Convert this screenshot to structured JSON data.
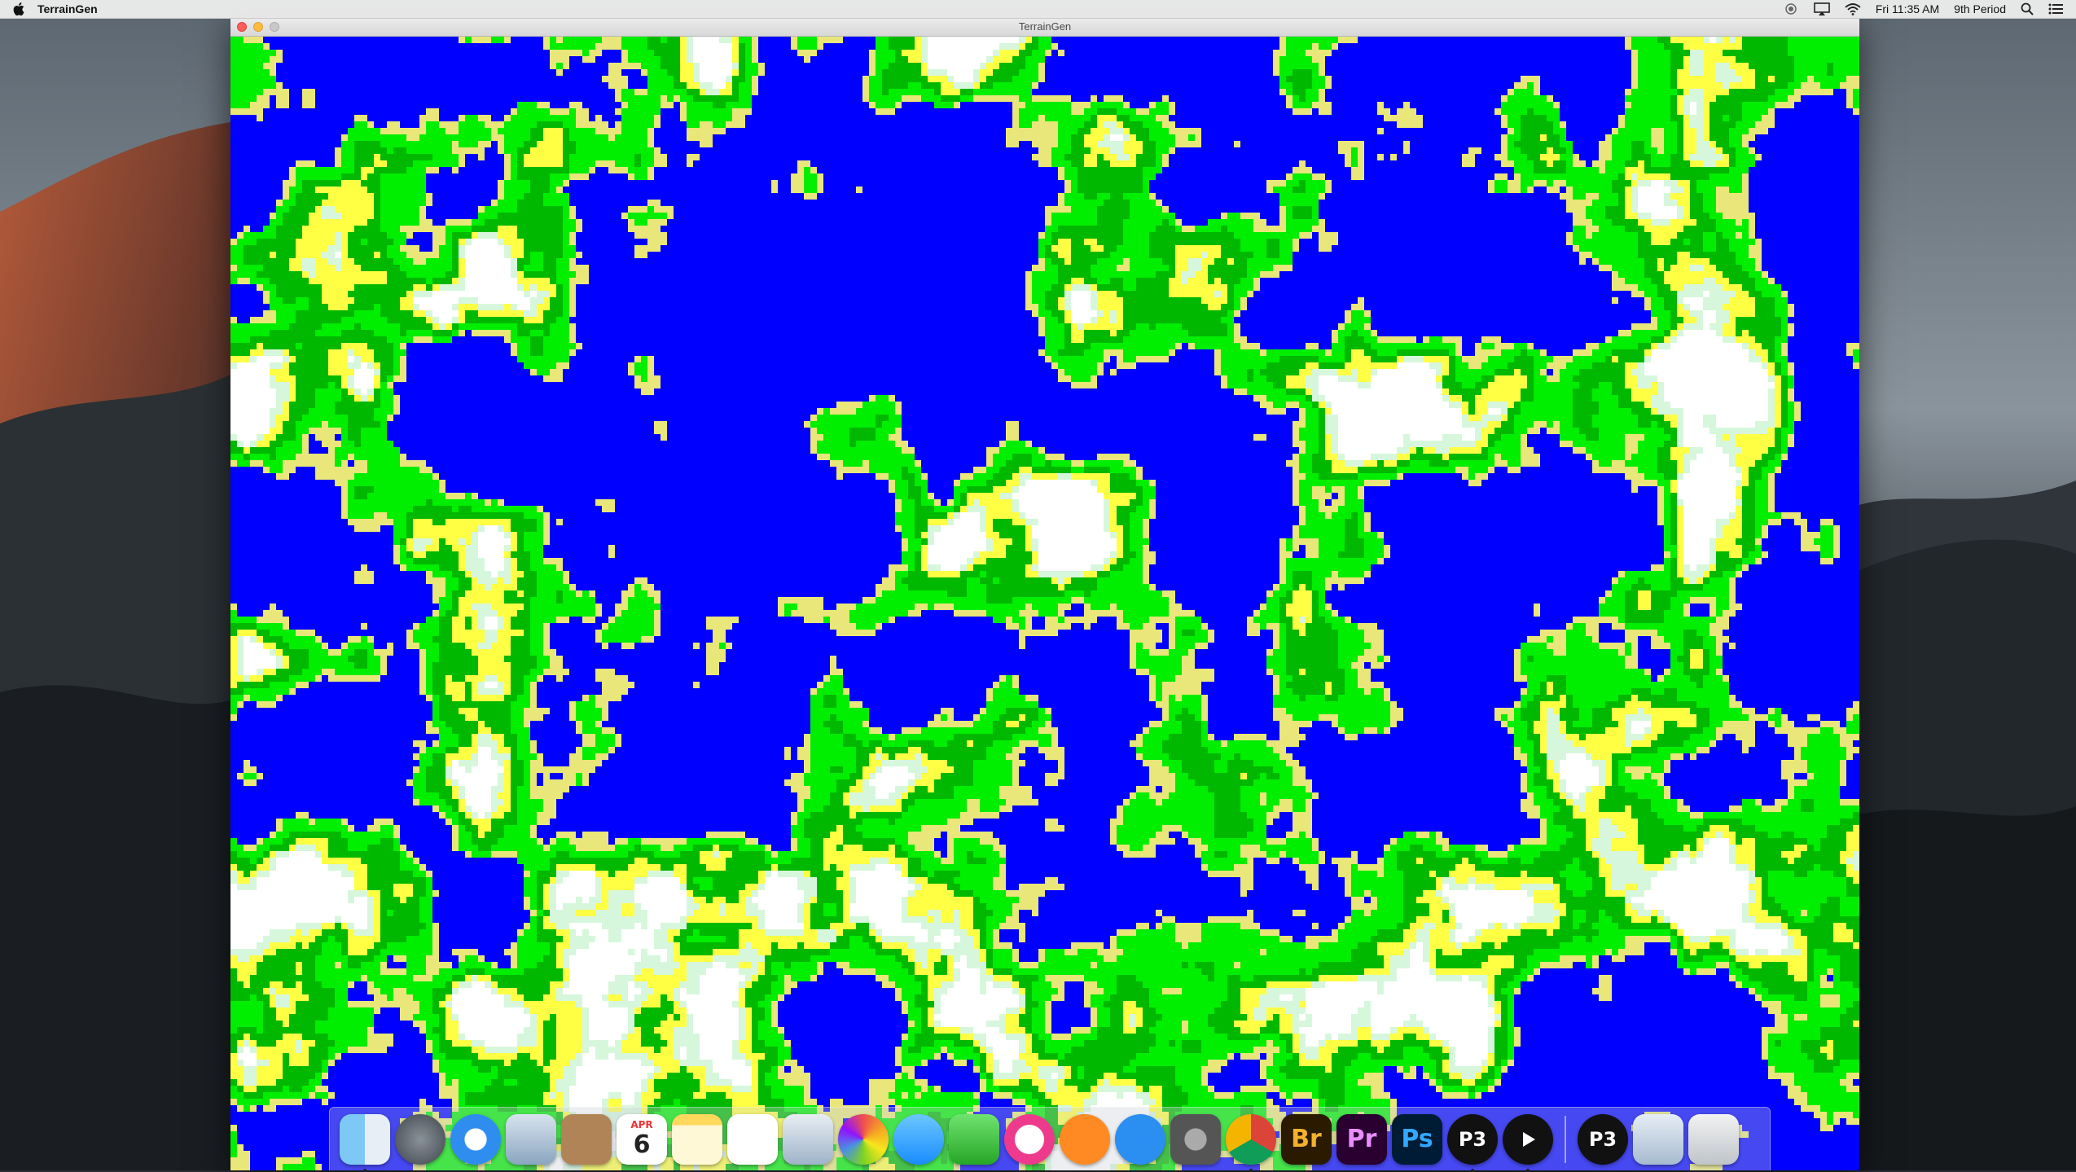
{
  "menubar": {
    "app_name": "TerrainGen",
    "clock": "Fri 11:35 AM",
    "user": "9th Period",
    "status_icons": [
      "camera-icon",
      "airplay-icon",
      "wifi-icon",
      "spotlight-icon",
      "notification-center-icon"
    ]
  },
  "window": {
    "title": "TerrainGen",
    "buttons": [
      "close",
      "minimize",
      "zoom"
    ]
  },
  "terrain": {
    "palette": {
      "water": "#0000ff",
      "sand": "#e9e67a",
      "bright_yellow": "#ffff44",
      "grass": "#00ee00",
      "forest": "#00b800",
      "snow": "#ffffff",
      "mint": "#d7f7dc"
    }
  },
  "dock": {
    "apps": [
      {
        "name": "finder",
        "label": "Finder",
        "running": true
      },
      {
        "name": "launchpad",
        "label": "Launchpad",
        "running": false
      },
      {
        "name": "safari",
        "label": "Safari",
        "running": false
      },
      {
        "name": "mail",
        "label": "Mail",
        "running": false
      },
      {
        "name": "contacts",
        "label": "Contacts",
        "running": false
      },
      {
        "name": "calendar",
        "label": "Calendar",
        "month": "APR",
        "day": "6",
        "running": false
      },
      {
        "name": "notes",
        "label": "Notes",
        "running": false
      },
      {
        "name": "reminders",
        "label": "Reminders",
        "running": false
      },
      {
        "name": "preview",
        "label": "Preview",
        "running": false
      },
      {
        "name": "photos",
        "label": "Photos",
        "running": false
      },
      {
        "name": "messages",
        "label": "Messages",
        "running": false
      },
      {
        "name": "facetime",
        "label": "FaceTime",
        "running": false
      },
      {
        "name": "itunes",
        "label": "iTunes",
        "running": false
      },
      {
        "name": "ibooks",
        "label": "iBooks",
        "running": false
      },
      {
        "name": "app-store",
        "label": "App Store",
        "running": false
      },
      {
        "name": "system-preferences",
        "label": "System Preferences",
        "running": false
      },
      {
        "name": "chrome",
        "label": "Google Chrome",
        "running": true
      },
      {
        "name": "bridge",
        "label": "Br",
        "running": false
      },
      {
        "name": "premiere",
        "label": "Pr",
        "running": false
      },
      {
        "name": "photoshop",
        "label": "Ps",
        "running": false
      },
      {
        "name": "processing",
        "label": "P3",
        "running": true
      },
      {
        "name": "player",
        "label": "Player",
        "running": true
      }
    ],
    "right": [
      {
        "name": "processing-doc",
        "label": "P3"
      },
      {
        "name": "downloads",
        "label": "Downloads"
      },
      {
        "name": "trash",
        "label": "Trash"
      }
    ]
  }
}
